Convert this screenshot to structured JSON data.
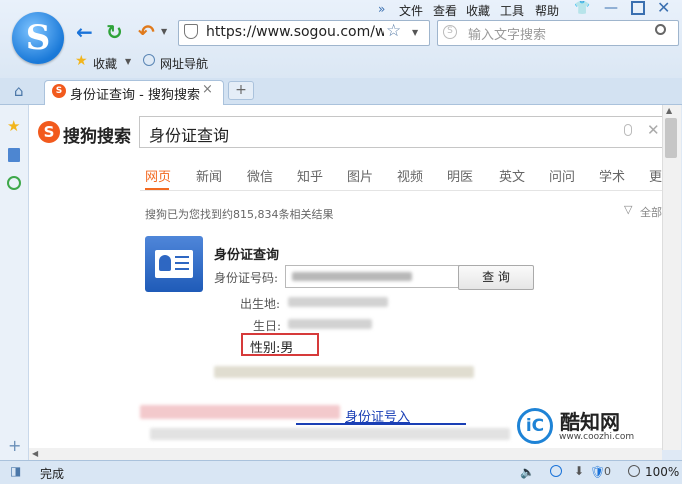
{
  "menu": {
    "items": [
      "文件",
      "查看",
      "收藏",
      "工具",
      "帮助"
    ]
  },
  "toolbar": {
    "favorites_label": "收藏",
    "url_nav_label": "网址导航",
    "url": "https://www.sogou.com/we",
    "search_placeholder": "输入文字搜索"
  },
  "tab": {
    "title": "身份证查询 - 搜狗搜索",
    "close": "×",
    "new": "+"
  },
  "sogou": {
    "brand": "搜狗搜索",
    "query": "身份证查询",
    "verticals": [
      "网页",
      "新闻",
      "微信",
      "知乎",
      "图片",
      "视频",
      "明医",
      "英文",
      "问问",
      "学术",
      "更"
    ],
    "result_count": "搜狗已为您找到约815,834条相关结果",
    "filter_label": "全部"
  },
  "card": {
    "title": "身份证查询",
    "id_label": "身份证号码:",
    "query_button": "查 询",
    "birthplace_label": "出生地:",
    "birthday_label": "生日:",
    "gender_label": "性别:",
    "gender_value": "男"
  },
  "bottom_link": "身份证号入",
  "watermark": {
    "name": "酷知网",
    "url": "www.coozhi.com"
  },
  "status": {
    "text": "完成",
    "zoom": "100%"
  },
  "colors": {
    "accent": "#f26a21",
    "highlight_border": "#d63a3a",
    "link": "#1a3fb5"
  }
}
